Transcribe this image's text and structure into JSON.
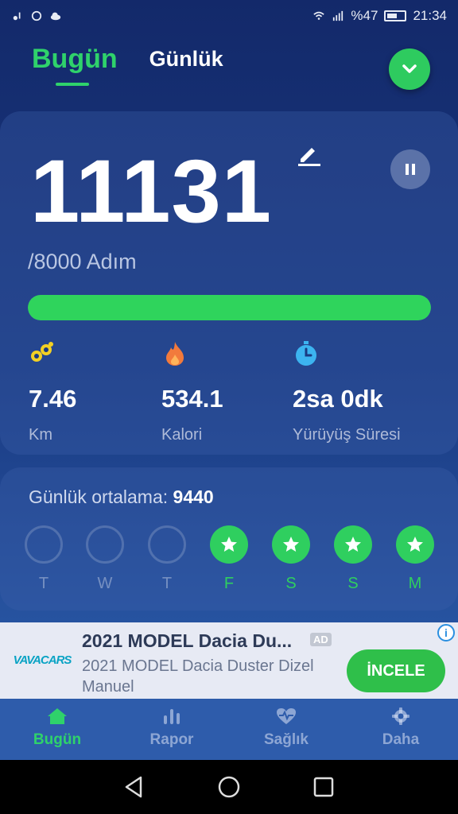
{
  "status_bar": {
    "battery_percent": "%47",
    "time": "21:34"
  },
  "header": {
    "tab_today": "Bugün",
    "tab_daily": "Günlük"
  },
  "today": {
    "steps": "11131",
    "goal": "/8000 Adım",
    "progress_fraction": 1.0,
    "stats": [
      {
        "value": "7.46",
        "label": "Km",
        "icon": "footprints-icon"
      },
      {
        "value": "534.1",
        "label": "Kalori",
        "icon": "flame-icon"
      },
      {
        "value": "2sa 0dk",
        "label": "Yürüyüş Süresi",
        "icon": "stopwatch-icon"
      }
    ]
  },
  "daily_average": {
    "label": "Günlük ortalama:",
    "value": "9440",
    "days": [
      {
        "label": "T",
        "achieved": false
      },
      {
        "label": "W",
        "achieved": false
      },
      {
        "label": "T",
        "achieved": false
      },
      {
        "label": "F",
        "achieved": true
      },
      {
        "label": "S",
        "achieved": true
      },
      {
        "label": "S",
        "achieved": true
      },
      {
        "label": "M",
        "achieved": true
      }
    ]
  },
  "ad": {
    "logo_text": "VAVACARS",
    "title": "2021 MODEL Dacia Du...",
    "badge": "AD",
    "description": "2021 MODEL Dacia Duster Dizel Manuel",
    "cta": "İNCELE",
    "info": "i"
  },
  "bottom_nav": {
    "items": [
      {
        "label": "Bugün",
        "icon": "home-icon",
        "active": true
      },
      {
        "label": "Rapor",
        "icon": "bar-chart-icon",
        "active": false
      },
      {
        "label": "Sağlık",
        "icon": "heart-pulse-icon",
        "active": false
      },
      {
        "label": "Daha",
        "icon": "gear-icon",
        "active": false
      }
    ]
  },
  "colors": {
    "accent": "#2fd26b",
    "background": "#1a3a82",
    "ad_cta": "#2fbf4a"
  }
}
